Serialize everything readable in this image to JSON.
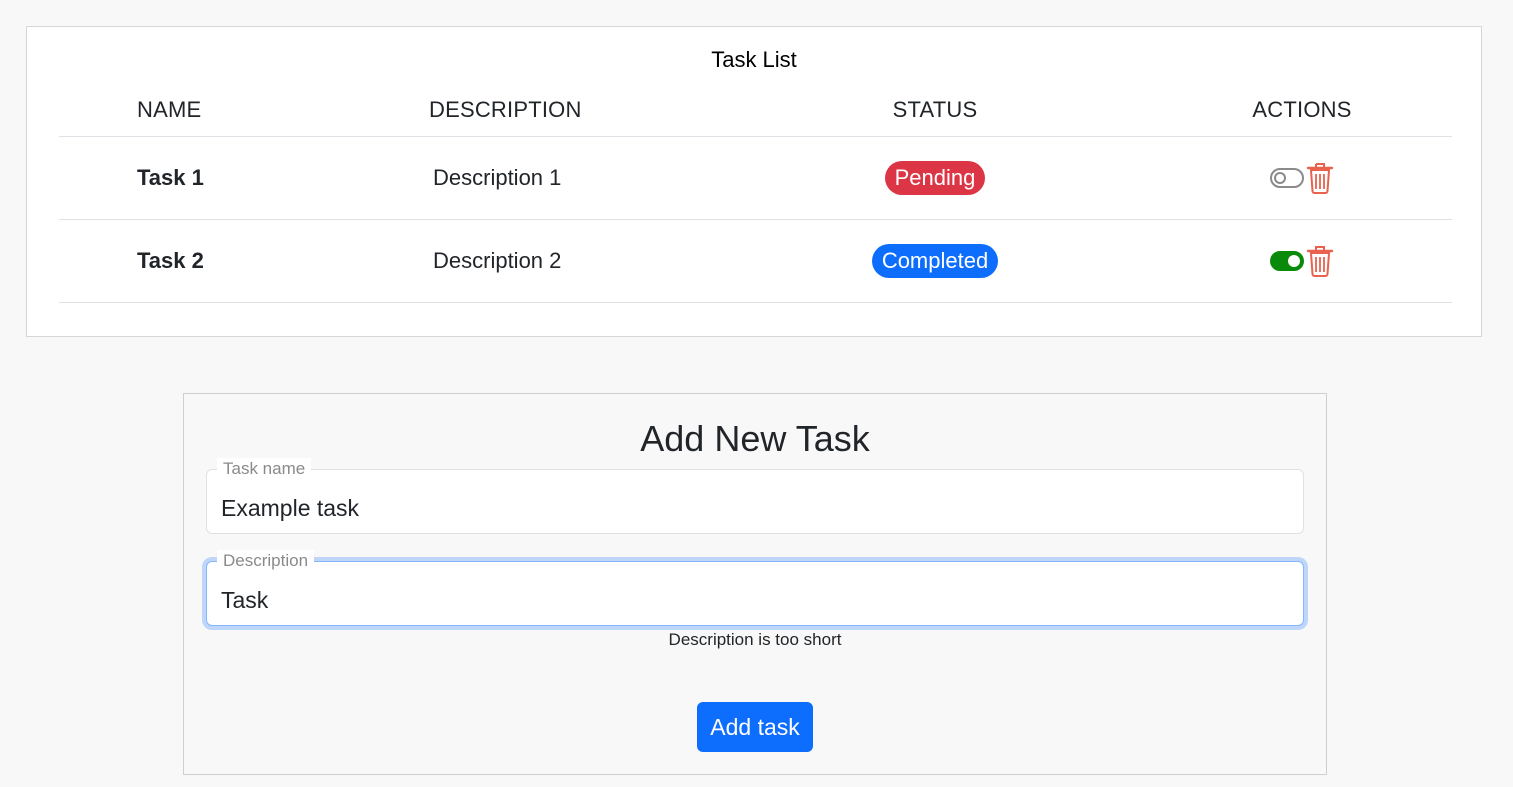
{
  "task_list": {
    "title": "Task List",
    "columns": [
      "NAME",
      "DESCRIPTION",
      "STATUS",
      "ACTIONS"
    ],
    "rows": [
      {
        "name": "Task 1",
        "description": "Description 1",
        "status": "Pending",
        "status_color": "#dc3545",
        "toggle": "off",
        "toggle_icon": "toggle-off-icon",
        "delete_icon": "trash-icon"
      },
      {
        "name": "Task 2",
        "description": "Description 2",
        "status": "Completed",
        "status_color": "#0d6efd",
        "toggle": "on",
        "toggle_icon": "toggle-on-icon",
        "delete_icon": "trash-icon"
      }
    ]
  },
  "add_form": {
    "title": "Add New Task",
    "name_field": {
      "label": "Task name",
      "value": "Example task"
    },
    "description_field": {
      "label": "Description",
      "value": "Task",
      "focused": true
    },
    "error": "Description is too short",
    "submit_label": "Add task"
  },
  "colors": {
    "primary": "#0d6efd",
    "danger": "#dc3545",
    "toggle_on": "#0a8a0a",
    "trash": "#e8624e"
  }
}
